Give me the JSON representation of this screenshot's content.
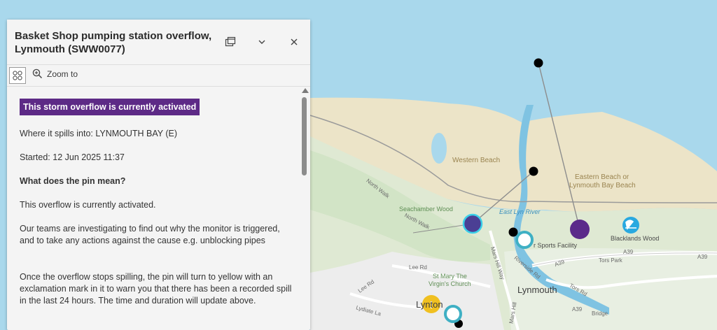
{
  "popup": {
    "title": "Basket Shop pumping station overflow, Lynmouth (SWW0077)",
    "toolbar": {
      "zoom_label": "Zoom to"
    },
    "status_badge": "This storm overflow is currently activated",
    "spills_into": "Where it spills into: LYNMOUTH BAY (E)",
    "started": "Started: 12 Jun 2025 11:37",
    "pin_heading": "What does the pin mean?",
    "pin_text_1": "This overflow is currently activated.",
    "pin_text_2": "Our teams are investigating to find out why the monitor is triggered, and to take any actions against the cause e.g. unblocking pipes",
    "pin_text_3": "Once the overflow stops spilling, the pin will turn to yellow with an exclamation mark in it to warn you that there has been a recorded spill in the last 24 hours. The time and duration will update above."
  },
  "map": {
    "labels": {
      "western_beach": "Western Beach",
      "eastern_beach_1": "Eastern Beach or",
      "eastern_beach_2": "Lynmouth Bay Beach",
      "seachamber_wood": "Seachamber Wood",
      "east_lyn_river": "East Lyn River",
      "north_walk_1": "North Walk",
      "north_walk_2": "North Walk",
      "sports_facility": "r Sports Facility",
      "blacklands_wood": "Blacklands Wood",
      "a39_1": "A39",
      "a39_2": "A39",
      "a39_3": "A39",
      "a39_4": "A39",
      "tors_park": "Tors Park",
      "tors_rd": "Tors Rd",
      "mars_hill_way": "Mars Hill Way",
      "riverside_rd": "Riverside Rd",
      "lee_rd": "Lee Rd",
      "lee_rd_2": "Lee Rd",
      "lydiate_la": "Lydiate La",
      "st_mary": "St Mary The",
      "virgins_church": "Virgin's Church",
      "lynmouth": "Lynmouth",
      "lynton": "Lynton",
      "mars_hill": "Mars Hill",
      "bridge": "Bridge"
    },
    "colors": {
      "sea": "#a9d8ec",
      "beach": "#ece4c8",
      "land": "#dfe9d3",
      "active_pin": "#4b3f94",
      "purple_pin": "#5b2a8a",
      "warning_pin": "#f0c020",
      "ring_pin": "#3fb0c4"
    }
  }
}
